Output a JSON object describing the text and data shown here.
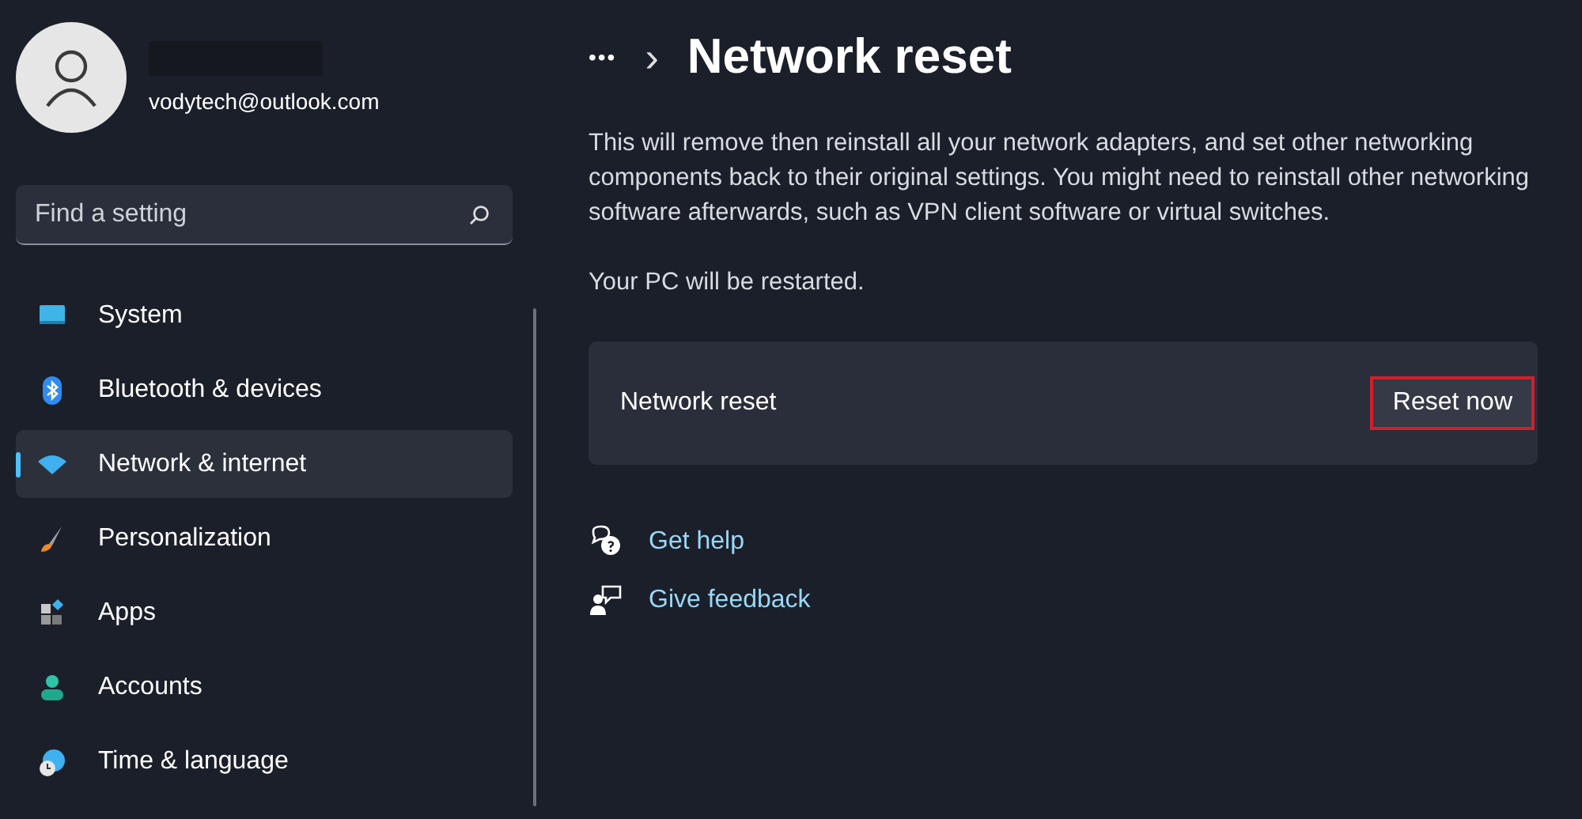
{
  "account": {
    "email": "vodytech@outlook.com",
    "name_redacted": true
  },
  "search": {
    "placeholder": "Find a setting"
  },
  "sidebar": {
    "items": [
      {
        "label": "System",
        "kind": "system",
        "selected": false
      },
      {
        "label": "Bluetooth & devices",
        "kind": "bluetooth",
        "selected": false
      },
      {
        "label": "Network & internet",
        "kind": "network",
        "selected": true
      },
      {
        "label": "Personalization",
        "kind": "brush",
        "selected": false
      },
      {
        "label": "Apps",
        "kind": "apps",
        "selected": false
      },
      {
        "label": "Accounts",
        "kind": "accounts",
        "selected": false
      },
      {
        "label": "Time & language",
        "kind": "time",
        "selected": false
      }
    ]
  },
  "breadcrumb": {
    "more": "•••",
    "separator": "›",
    "title": "Network reset"
  },
  "description": "This will remove then reinstall all your network adapters, and set other networking components back to their original settings. You might need to reinstall other networking software afterwards, such as VPN client software or virtual switches.",
  "restart_note": "Your PC will be restarted.",
  "reset_card": {
    "label": "Network reset",
    "button": "Reset now",
    "highlighted": true
  },
  "links": [
    {
      "label": "Get help",
      "kind": "help"
    },
    {
      "label": "Give feedback",
      "kind": "feedback"
    }
  ]
}
